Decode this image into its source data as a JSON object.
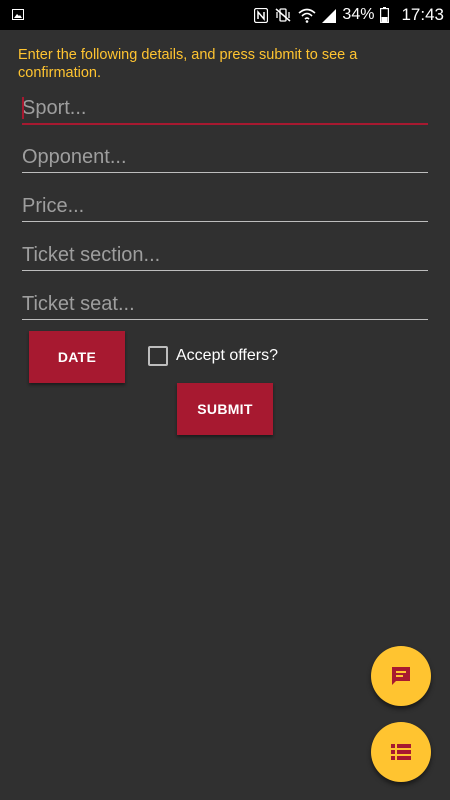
{
  "status_bar": {
    "battery": "34%",
    "time": "17:43"
  },
  "instructions": "Enter the following details, and press submit to see a confirmation.",
  "form": {
    "sport_placeholder": "Sport...",
    "opponent_placeholder": "Opponent...",
    "price_placeholder": "Price...",
    "ticket_section_placeholder": "Ticket section...",
    "ticket_seat_placeholder": "Ticket seat...",
    "date_label": "DATE",
    "accept_offers_label": "Accept offers?",
    "accept_offers_checked": false,
    "submit_label": "SUBMIT"
  },
  "fabs": {
    "message_icon": "message-icon",
    "list_icon": "list-icon"
  },
  "colors": {
    "background": "#303030",
    "accent": "#a71930",
    "yellow": "#ffc430"
  }
}
